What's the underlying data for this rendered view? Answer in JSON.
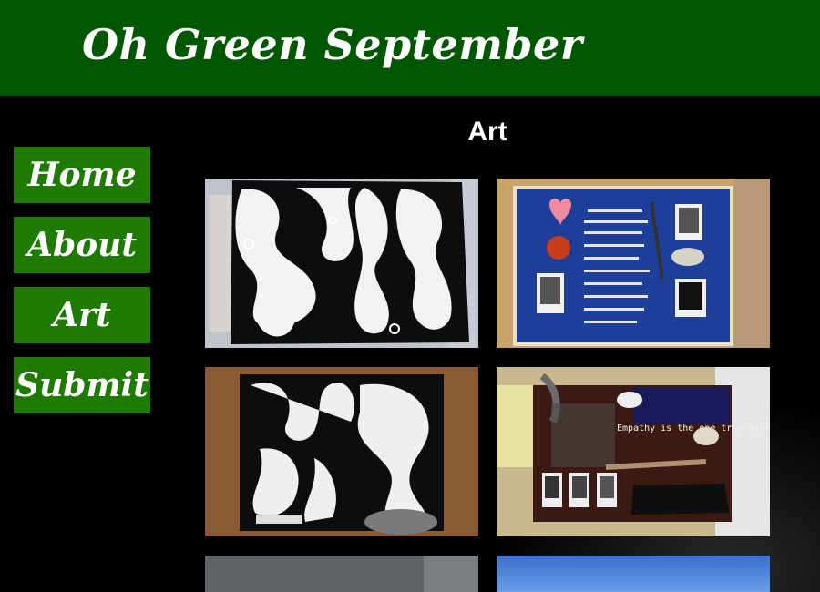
{
  "header": {
    "site_title": "Oh Green September",
    "background": "#005700"
  },
  "nav": {
    "items": [
      {
        "label": "Home"
      },
      {
        "label": "About"
      },
      {
        "label": "Art"
      },
      {
        "label": "Submit"
      }
    ],
    "button_color": "#1e7a00"
  },
  "main": {
    "heading": "Art",
    "gallery": [
      {
        "name": "black and white abstract painting"
      },
      {
        "name": "blue collage with photos, heart and feather"
      },
      {
        "name": "black and white abstract painting with swirls"
      },
      {
        "name": "dark collage with feather and photos",
        "text": "Empathy is the one true faith"
      },
      {
        "name": "gray photo (partially visible)"
      },
      {
        "name": "blue sky photo (partially visible)"
      }
    ]
  }
}
